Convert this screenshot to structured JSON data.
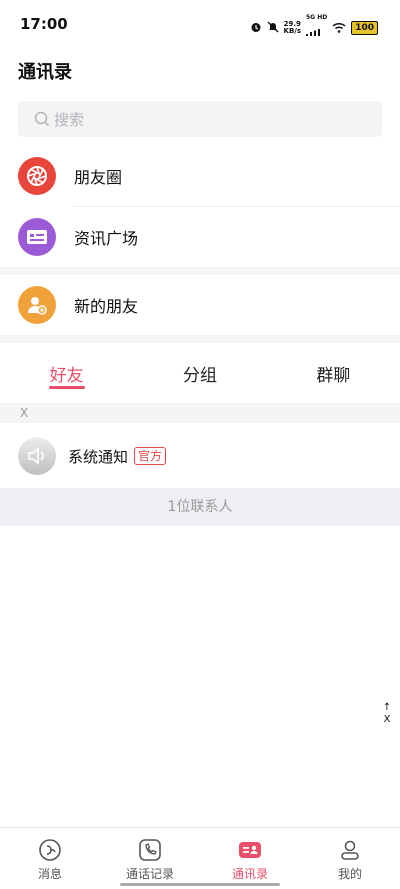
{
  "status_bar": {
    "time": "17:00",
    "speed_value": "29.9",
    "speed_unit": "KB/s",
    "network": "5G HD",
    "battery": "100"
  },
  "page": {
    "title": "通讯录"
  },
  "search": {
    "placeholder": "搜索"
  },
  "entries": [
    {
      "label": "朋友圈",
      "icon": "camera-aperture-icon",
      "color": "#e8463c"
    },
    {
      "label": "资讯广场",
      "icon": "news-card-icon",
      "color": "#9b5ad6"
    },
    {
      "label": "新的朋友",
      "icon": "add-friend-icon",
      "color": "#f0a13a"
    }
  ],
  "tabs": [
    {
      "label": "好友",
      "active": true
    },
    {
      "label": "分组",
      "active": false
    },
    {
      "label": "群聊",
      "active": false
    }
  ],
  "section": {
    "letter": "X"
  },
  "contacts": [
    {
      "name": "系统通知",
      "badge": "官方",
      "icon": "speaker-icon"
    }
  ],
  "contact_count": "1位联系人",
  "index_sidebar": {
    "arrow": "↑",
    "letter": "X"
  },
  "bottom_nav": [
    {
      "label": "消息",
      "icon": "message-icon",
      "active": false
    },
    {
      "label": "通话记录",
      "icon": "call-log-icon",
      "active": false
    },
    {
      "label": "通讯录",
      "icon": "contacts-icon",
      "active": true
    },
    {
      "label": "我的",
      "icon": "profile-icon",
      "active": false
    }
  ],
  "colors": {
    "accent": "#e94f6a",
    "badge": "#e04a4a",
    "divider": "#f4f4f6"
  }
}
